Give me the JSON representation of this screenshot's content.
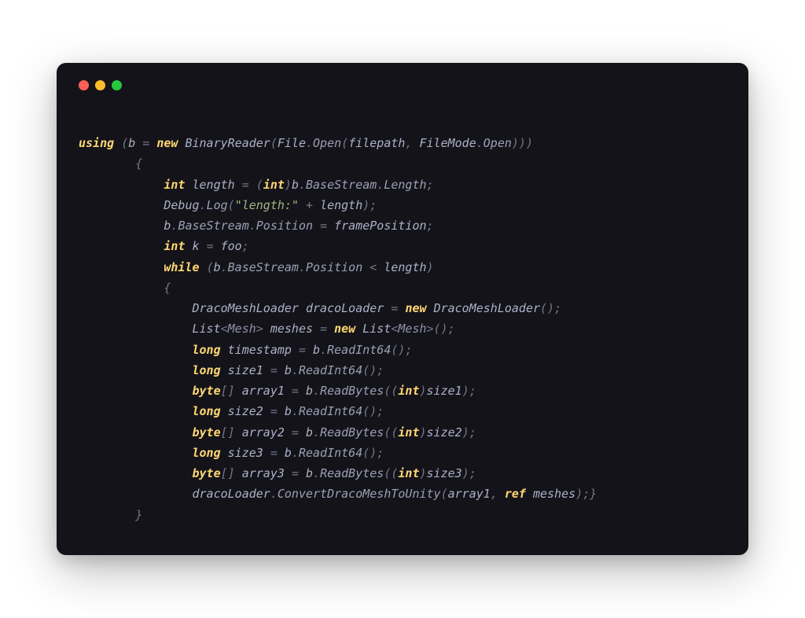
{
  "code": {
    "tokens": [
      [
        {
          "t": "using ",
          "c": "kw"
        },
        {
          "t": "(",
          "c": "punc"
        },
        {
          "t": "b ",
          "c": "id"
        },
        {
          "t": "= ",
          "c": "punc"
        },
        {
          "t": "new ",
          "c": "kw2"
        },
        {
          "t": "BinaryReader",
          "c": "id"
        },
        {
          "t": "(",
          "c": "punc"
        },
        {
          "t": "File",
          "c": "id"
        },
        {
          "t": ".",
          "c": "punc"
        },
        {
          "t": "Open",
          "c": "prop"
        },
        {
          "t": "(",
          "c": "punc"
        },
        {
          "t": "filepath",
          "c": "id"
        },
        {
          "t": ", ",
          "c": "punc"
        },
        {
          "t": "FileMode",
          "c": "id"
        },
        {
          "t": ".",
          "c": "punc"
        },
        {
          "t": "Open",
          "c": "prop"
        },
        {
          "t": ")))",
          "c": "punc"
        }
      ],
      [
        {
          "t": "        {",
          "c": "punc"
        }
      ],
      [
        {
          "t": "            ",
          "c": "punc"
        },
        {
          "t": "int ",
          "c": "kw"
        },
        {
          "t": "length ",
          "c": "id"
        },
        {
          "t": "= ",
          "c": "punc"
        },
        {
          "t": "(",
          "c": "punc"
        },
        {
          "t": "int",
          "c": "kw"
        },
        {
          "t": ")",
          "c": "punc"
        },
        {
          "t": "b",
          "c": "id"
        },
        {
          "t": ".",
          "c": "punc"
        },
        {
          "t": "BaseStream",
          "c": "prop"
        },
        {
          "t": ".",
          "c": "punc"
        },
        {
          "t": "Length",
          "c": "prop"
        },
        {
          "t": ";",
          "c": "punc"
        }
      ],
      [
        {
          "t": "            ",
          "c": "punc"
        },
        {
          "t": "Debug",
          "c": "id"
        },
        {
          "t": ".",
          "c": "punc"
        },
        {
          "t": "Log",
          "c": "prop"
        },
        {
          "t": "(",
          "c": "punc"
        },
        {
          "t": "\"length:\"",
          "c": "str"
        },
        {
          "t": " + ",
          "c": "punc"
        },
        {
          "t": "length",
          "c": "id"
        },
        {
          "t": ");",
          "c": "punc"
        }
      ],
      [
        {
          "t": "            ",
          "c": "punc"
        },
        {
          "t": "b",
          "c": "id"
        },
        {
          "t": ".",
          "c": "punc"
        },
        {
          "t": "BaseStream",
          "c": "prop"
        },
        {
          "t": ".",
          "c": "punc"
        },
        {
          "t": "Position ",
          "c": "prop"
        },
        {
          "t": "= ",
          "c": "punc"
        },
        {
          "t": "framePosition",
          "c": "id"
        },
        {
          "t": ";",
          "c": "punc"
        }
      ],
      [
        {
          "t": "            ",
          "c": "punc"
        },
        {
          "t": "int ",
          "c": "kw"
        },
        {
          "t": "k ",
          "c": "id"
        },
        {
          "t": "= ",
          "c": "punc"
        },
        {
          "t": "foo",
          "c": "id"
        },
        {
          "t": ";",
          "c": "punc"
        }
      ],
      [
        {
          "t": "            ",
          "c": "punc"
        },
        {
          "t": "while ",
          "c": "kw"
        },
        {
          "t": "(",
          "c": "punc"
        },
        {
          "t": "b",
          "c": "id"
        },
        {
          "t": ".",
          "c": "punc"
        },
        {
          "t": "BaseStream",
          "c": "prop"
        },
        {
          "t": ".",
          "c": "punc"
        },
        {
          "t": "Position ",
          "c": "prop"
        },
        {
          "t": "< ",
          "c": "punc"
        },
        {
          "t": "length",
          "c": "id"
        },
        {
          "t": ")",
          "c": "punc"
        }
      ],
      [
        {
          "t": "            {",
          "c": "punc"
        }
      ],
      [
        {
          "t": "                ",
          "c": "punc"
        },
        {
          "t": "DracoMeshLoader ",
          "c": "id"
        },
        {
          "t": "dracoLoader ",
          "c": "id"
        },
        {
          "t": "= ",
          "c": "punc"
        },
        {
          "t": "new ",
          "c": "kw2"
        },
        {
          "t": "DracoMeshLoader",
          "c": "id"
        },
        {
          "t": "();",
          "c": "punc"
        }
      ],
      [
        {
          "t": "                ",
          "c": "punc"
        },
        {
          "t": "List",
          "c": "id"
        },
        {
          "t": "<",
          "c": "punc"
        },
        {
          "t": "Mesh",
          "c": "type"
        },
        {
          "t": "> ",
          "c": "punc"
        },
        {
          "t": "meshes ",
          "c": "id"
        },
        {
          "t": "= ",
          "c": "punc"
        },
        {
          "t": "new ",
          "c": "kw2"
        },
        {
          "t": "List",
          "c": "id"
        },
        {
          "t": "<",
          "c": "punc"
        },
        {
          "t": "Mesh",
          "c": "type"
        },
        {
          "t": ">();",
          "c": "punc"
        }
      ],
      [
        {
          "t": "                ",
          "c": "punc"
        },
        {
          "t": "long ",
          "c": "kw"
        },
        {
          "t": "timestamp ",
          "c": "id"
        },
        {
          "t": "= ",
          "c": "punc"
        },
        {
          "t": "b",
          "c": "id"
        },
        {
          "t": ".",
          "c": "punc"
        },
        {
          "t": "ReadInt64",
          "c": "prop"
        },
        {
          "t": "();",
          "c": "punc"
        }
      ],
      [
        {
          "t": "                ",
          "c": "punc"
        },
        {
          "t": "long ",
          "c": "kw"
        },
        {
          "t": "size1 ",
          "c": "id"
        },
        {
          "t": "= ",
          "c": "punc"
        },
        {
          "t": "b",
          "c": "id"
        },
        {
          "t": ".",
          "c": "punc"
        },
        {
          "t": "ReadInt64",
          "c": "prop"
        },
        {
          "t": "();",
          "c": "punc"
        }
      ],
      [
        {
          "t": "                ",
          "c": "punc"
        },
        {
          "t": "byte",
          "c": "kw"
        },
        {
          "t": "[] ",
          "c": "punc"
        },
        {
          "t": "array1 ",
          "c": "id"
        },
        {
          "t": "= ",
          "c": "punc"
        },
        {
          "t": "b",
          "c": "id"
        },
        {
          "t": ".",
          "c": "punc"
        },
        {
          "t": "ReadBytes",
          "c": "prop"
        },
        {
          "t": "((",
          "c": "punc"
        },
        {
          "t": "int",
          "c": "kw"
        },
        {
          "t": ")",
          "c": "punc"
        },
        {
          "t": "size1",
          "c": "id"
        },
        {
          "t": ");",
          "c": "punc"
        }
      ],
      [
        {
          "t": "                ",
          "c": "punc"
        },
        {
          "t": "long ",
          "c": "kw"
        },
        {
          "t": "size2 ",
          "c": "id"
        },
        {
          "t": "= ",
          "c": "punc"
        },
        {
          "t": "b",
          "c": "id"
        },
        {
          "t": ".",
          "c": "punc"
        },
        {
          "t": "ReadInt64",
          "c": "prop"
        },
        {
          "t": "();",
          "c": "punc"
        }
      ],
      [
        {
          "t": "                ",
          "c": "punc"
        },
        {
          "t": "byte",
          "c": "kw"
        },
        {
          "t": "[] ",
          "c": "punc"
        },
        {
          "t": "array2 ",
          "c": "id"
        },
        {
          "t": "= ",
          "c": "punc"
        },
        {
          "t": "b",
          "c": "id"
        },
        {
          "t": ".",
          "c": "punc"
        },
        {
          "t": "ReadBytes",
          "c": "prop"
        },
        {
          "t": "((",
          "c": "punc"
        },
        {
          "t": "int",
          "c": "kw"
        },
        {
          "t": ")",
          "c": "punc"
        },
        {
          "t": "size2",
          "c": "id"
        },
        {
          "t": ");",
          "c": "punc"
        }
      ],
      [
        {
          "t": "                ",
          "c": "punc"
        },
        {
          "t": "long ",
          "c": "kw"
        },
        {
          "t": "size3 ",
          "c": "id"
        },
        {
          "t": "= ",
          "c": "punc"
        },
        {
          "t": "b",
          "c": "id"
        },
        {
          "t": ".",
          "c": "punc"
        },
        {
          "t": "ReadInt64",
          "c": "prop"
        },
        {
          "t": "();",
          "c": "punc"
        }
      ],
      [
        {
          "t": "                ",
          "c": "punc"
        },
        {
          "t": "byte",
          "c": "kw"
        },
        {
          "t": "[] ",
          "c": "punc"
        },
        {
          "t": "array3 ",
          "c": "id"
        },
        {
          "t": "= ",
          "c": "punc"
        },
        {
          "t": "b",
          "c": "id"
        },
        {
          "t": ".",
          "c": "punc"
        },
        {
          "t": "ReadBytes",
          "c": "prop"
        },
        {
          "t": "((",
          "c": "punc"
        },
        {
          "t": "int",
          "c": "kw"
        },
        {
          "t": ")",
          "c": "punc"
        },
        {
          "t": "size3",
          "c": "id"
        },
        {
          "t": ");",
          "c": "punc"
        }
      ],
      [
        {
          "t": "                ",
          "c": "punc"
        },
        {
          "t": "dracoLoader",
          "c": "id"
        },
        {
          "t": ".",
          "c": "punc"
        },
        {
          "t": "ConvertDracoMeshToUnity",
          "c": "prop"
        },
        {
          "t": "(",
          "c": "punc"
        },
        {
          "t": "array1",
          "c": "id"
        },
        {
          "t": ", ",
          "c": "punc"
        },
        {
          "t": "ref ",
          "c": "kw"
        },
        {
          "t": "meshes",
          "c": "id"
        },
        {
          "t": ");}",
          "c": "punc"
        }
      ],
      [
        {
          "t": "        }",
          "c": "punc"
        }
      ]
    ]
  }
}
